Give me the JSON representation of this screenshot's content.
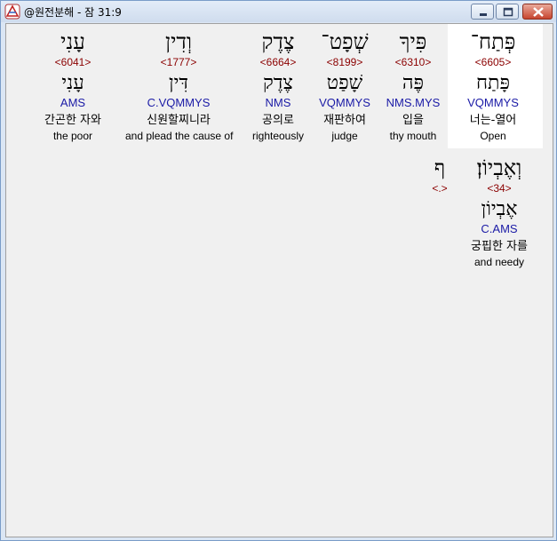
{
  "window": {
    "title": "@원전분해 - 잠 31:9"
  },
  "words": [
    {
      "hebrew": "פְּתַח־",
      "strong": "<6605>",
      "lemma": "פָּתַח",
      "morph": "VQMMYS",
      "korean": "너는-열어",
      "english": "Open",
      "highlighted": true
    },
    {
      "hebrew": "פִּיךָ",
      "strong": "<6310>",
      "lemma": "פֶּה",
      "morph": "NMS.MYS",
      "korean": "입을",
      "english": "thy mouth",
      "highlighted": false
    },
    {
      "hebrew": "שְׁפָט־",
      "strong": "<8199>",
      "lemma": "שָׁפַט",
      "morph": "VQMMYS",
      "korean": "재판하여",
      "english": "judge",
      "highlighted": false
    },
    {
      "hebrew": "צֶדֶק",
      "strong": "<6664>",
      "lemma": "צֶדֶק",
      "morph": "NMS",
      "korean": "공의로",
      "english": "righteously",
      "highlighted": false
    },
    {
      "hebrew": "וְדִין",
      "strong": "<1777>",
      "lemma": "דִּין",
      "morph": "C.VQMMYS",
      "korean": "신원할찌니라",
      "english": "and plead the cause of",
      "highlighted": false
    },
    {
      "hebrew": "עָנִי",
      "strong": "<6041>",
      "lemma": "עָנִי",
      "morph": "AMS",
      "korean": "간곤한 자와",
      "english": "the poor",
      "highlighted": false
    },
    {
      "hebrew": "וְאֶבְיוֹן׃",
      "strong": "<34>",
      "lemma": "אֶבְיוֹן",
      "morph": "C.AMS",
      "korean": "궁핍한 자를",
      "english": "and needy",
      "highlighted": false
    },
    {
      "hebrew": "ף",
      "strong": "<.>",
      "lemma": "",
      "morph": "",
      "korean": "",
      "english": "",
      "highlighted": false
    }
  ]
}
